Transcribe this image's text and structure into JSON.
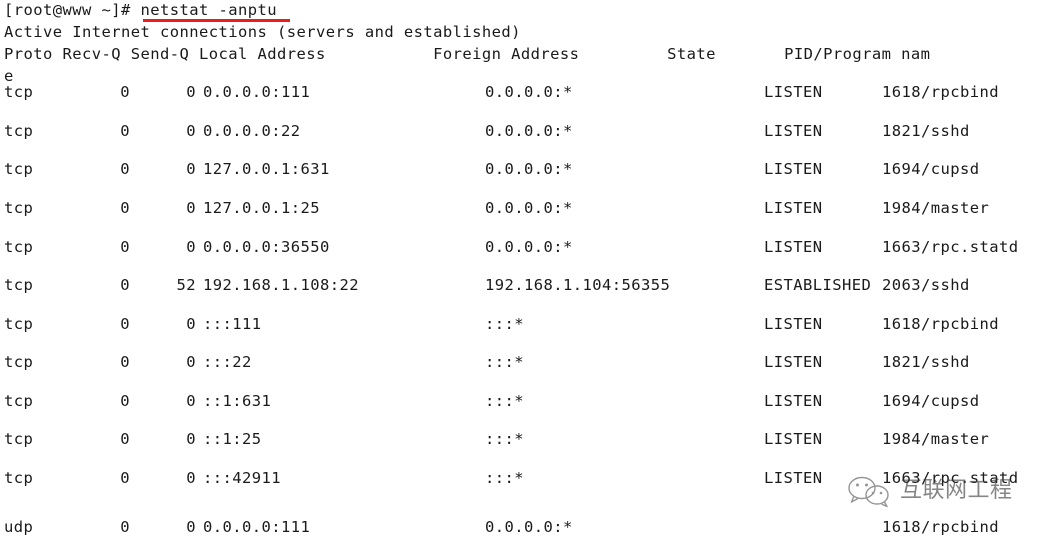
{
  "terminal": {
    "prompt": "[root@www ~]# ",
    "command": "netstat -anptu",
    "banner": "Active Internet connections (servers and established)",
    "column_header": "Proto Recv-Q Send-Q Local Address           Foreign Address         State       PID/Program nam",
    "column_header_wrap": "e",
    "accent_underline_color": "#f01c1c",
    "foreground_color": "#1a1a1a",
    "background_color": "#ffffff"
  },
  "columns": {
    "proto": "Proto",
    "recvq": "Recv-Q",
    "sendq": "Send-Q",
    "local_address": "Local Address",
    "foreign_address": "Foreign Address",
    "state": "State",
    "pid_program": "PID/Program name"
  },
  "rows": [
    {
      "proto": "tcp",
      "recvq": "0",
      "sendq": "0",
      "local": "0.0.0.0:111",
      "foreign": "0.0.0.0:*",
      "state": "LISTEN",
      "pid": "1618/rpcbind"
    },
    {
      "proto": "tcp",
      "recvq": "0",
      "sendq": "0",
      "local": "0.0.0.0:22",
      "foreign": "0.0.0.0:*",
      "state": "LISTEN",
      "pid": "1821/sshd"
    },
    {
      "proto": "tcp",
      "recvq": "0",
      "sendq": "0",
      "local": "127.0.0.1:631",
      "foreign": "0.0.0.0:*",
      "state": "LISTEN",
      "pid": "1694/cupsd"
    },
    {
      "proto": "tcp",
      "recvq": "0",
      "sendq": "0",
      "local": "127.0.0.1:25",
      "foreign": "0.0.0.0:*",
      "state": "LISTEN",
      "pid": "1984/master"
    },
    {
      "proto": "tcp",
      "recvq": "0",
      "sendq": "0",
      "local": "0.0.0.0:36550",
      "foreign": "0.0.0.0:*",
      "state": "LISTEN",
      "pid": "1663/rpc.statd"
    },
    {
      "proto": "tcp",
      "recvq": "0",
      "sendq": "52",
      "local": "192.168.1.108:22",
      "foreign": "192.168.1.104:56355",
      "state": "ESTABLISHED",
      "pid": "2063/sshd"
    },
    {
      "proto": "tcp",
      "recvq": "0",
      "sendq": "0",
      "local": ":::111",
      "foreign": ":::*",
      "state": "LISTEN",
      "pid": "1618/rpcbind"
    },
    {
      "proto": "tcp",
      "recvq": "0",
      "sendq": "0",
      "local": ":::22",
      "foreign": ":::*",
      "state": "LISTEN",
      "pid": "1821/sshd"
    },
    {
      "proto": "tcp",
      "recvq": "0",
      "sendq": "0",
      "local": "::1:631",
      "foreign": ":::*",
      "state": "LISTEN",
      "pid": "1694/cupsd"
    },
    {
      "proto": "tcp",
      "recvq": "0",
      "sendq": "0",
      "local": "::1:25",
      "foreign": ":::*",
      "state": "LISTEN",
      "pid": "1984/master"
    },
    {
      "proto": "tcp",
      "recvq": "0",
      "sendq": "0",
      "local": ":::42911",
      "foreign": ":::*",
      "state": "LISTEN",
      "pid": "1663/rpc.statd"
    },
    {
      "proto": "udp",
      "recvq": "0",
      "sendq": "0",
      "local": "0.0.0.0:111",
      "foreign": "0.0.0.0:*",
      "state": "",
      "pid": "1618/rpcbind"
    }
  ],
  "watermark": {
    "text": "互联网工程",
    "icon": "wechat-logo-icon"
  }
}
